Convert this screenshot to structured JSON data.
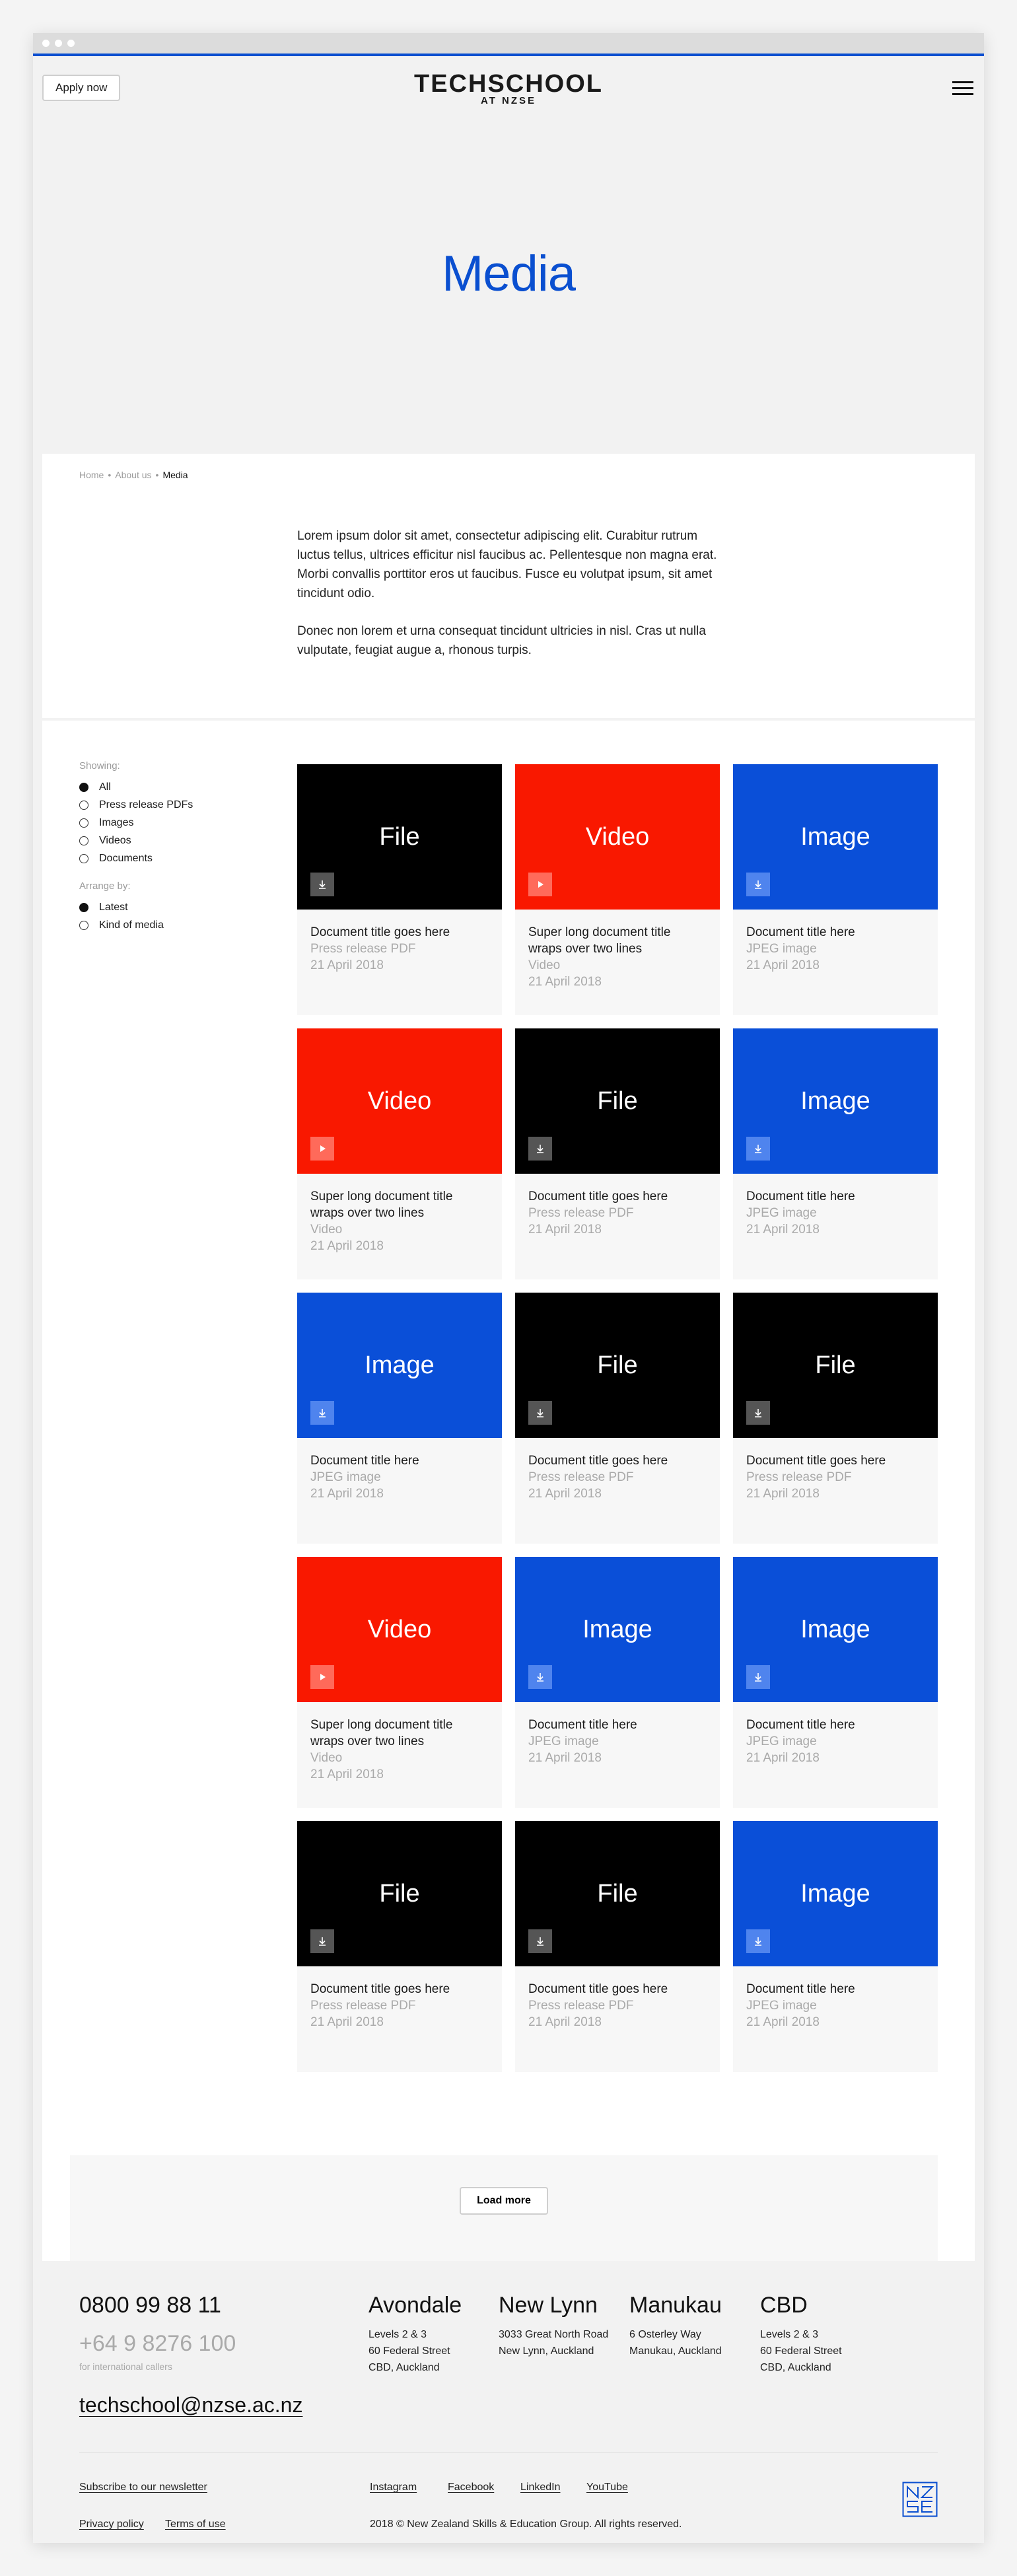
{
  "header": {
    "apply_label": "Apply now",
    "logo_main": "TECHSCHOOL",
    "logo_sub": "AT NZSE"
  },
  "hero": {
    "title": "Media"
  },
  "breadcrumb": {
    "home": "Home",
    "about": "About us",
    "current": "Media"
  },
  "intro": {
    "p1": "Lorem ipsum dolor sit amet, consectetur adipiscing elit. Curabitur rutrum luctus tellus, ultrices efficitur nisl faucibus ac. Pellentesque non magna erat. Morbi convallis porttitor eros ut faucibus. Fusce eu volutpat ipsum, sit amet tincidunt odio.",
    "p2": "Donec non lorem et urna consequat tincidunt ultricies in nisl. Cras ut nulla vulputate, feugiat augue a, rhonous turpis."
  },
  "filters": {
    "showing_label": "Showing:",
    "showing": [
      {
        "label": "All",
        "selected": true
      },
      {
        "label": "Press release PDFs",
        "selected": false
      },
      {
        "label": "Images",
        "selected": false
      },
      {
        "label": "Videos",
        "selected": false
      },
      {
        "label": "Documents",
        "selected": false
      }
    ],
    "arrange_label": "Arrange by:",
    "arrange": [
      {
        "label": "Latest",
        "selected": true
      },
      {
        "label": "Kind of media",
        "selected": false
      }
    ]
  },
  "cards": [
    {
      "type": "file",
      "label": "File",
      "title": "Document title goes here",
      "kind": "Press release PDF",
      "date": "21 April 2018"
    },
    {
      "type": "video",
      "label": "Video",
      "title": "Super long document title wraps over two lines",
      "kind": "Video",
      "date": "21 April 2018"
    },
    {
      "type": "image",
      "label": "Image",
      "title": "Document title here",
      "kind": "JPEG image",
      "date": "21 April 2018"
    },
    {
      "type": "video",
      "label": "Video",
      "title": "Super long document title wraps over two lines",
      "kind": "Video",
      "date": "21 April 2018"
    },
    {
      "type": "file",
      "label": "File",
      "title": "Document title goes here",
      "kind": "Press release PDF",
      "date": "21 April 2018"
    },
    {
      "type": "image",
      "label": "Image",
      "title": "Document title here",
      "kind": "JPEG image",
      "date": "21 April 2018"
    },
    {
      "type": "image",
      "label": "Image",
      "title": "Document title here",
      "kind": "JPEG image",
      "date": "21 April 2018"
    },
    {
      "type": "file",
      "label": "File",
      "title": "Document title goes here",
      "kind": "Press release PDF",
      "date": "21 April 2018"
    },
    {
      "type": "file",
      "label": "File",
      "title": "Document title goes here",
      "kind": "Press release PDF",
      "date": "21 April 2018"
    },
    {
      "type": "video",
      "label": "Video",
      "title": "Super long document title wraps over two lines",
      "kind": "Video",
      "date": "21 April 2018"
    },
    {
      "type": "image",
      "label": "Image",
      "title": "Document title here",
      "kind": "JPEG image",
      "date": "21 April 2018"
    },
    {
      "type": "image",
      "label": "Image",
      "title": "Document title here",
      "kind": "JPEG image",
      "date": "21 April 2018"
    },
    {
      "type": "file",
      "label": "File",
      "title": "Document title goes here",
      "kind": "Press release PDF",
      "date": "21 April 2018"
    },
    {
      "type": "file",
      "label": "File",
      "title": "Document title goes here",
      "kind": "Press release PDF",
      "date": "21 April 2018"
    },
    {
      "type": "image",
      "label": "Image",
      "title": "Document title here",
      "kind": "JPEG image",
      "date": "21 April 2018"
    }
  ],
  "load_more_label": "Load more",
  "footer": {
    "phone": "0800 99 88 11",
    "phone_intl": "+64 9 8276 100",
    "intl_note": "for international callers",
    "email": "techschool@nzse.ac.nz",
    "locations": [
      {
        "name": "Avondale",
        "lines": [
          "Levels 2 & 3",
          "60 Federal Street",
          "CBD, Auckland"
        ]
      },
      {
        "name": "New Lynn",
        "lines": [
          "3033 Great North Road",
          "New Lynn, Auckland"
        ]
      },
      {
        "name": "Manukau",
        "lines": [
          "6 Osterley Way",
          "Manukau, Auckland"
        ]
      },
      {
        "name": "CBD",
        "lines": [
          "Levels 2 & 3",
          "60 Federal Street",
          "CBD, Auckland"
        ]
      }
    ],
    "newsletter": "Subscribe to our newsletter",
    "privacy": "Privacy policy",
    "terms": "Terms of use",
    "social": [
      "Instagram",
      "Facebook",
      "LinkedIn",
      "YouTube"
    ],
    "copyright": "2018 © New Zealand Skills & Education Group. All rights reserved."
  },
  "colors": {
    "accent_blue": "#0a4fd0",
    "video_red": "#f91800",
    "image_blue": "#0a4fd8",
    "file_black": "#000000"
  }
}
